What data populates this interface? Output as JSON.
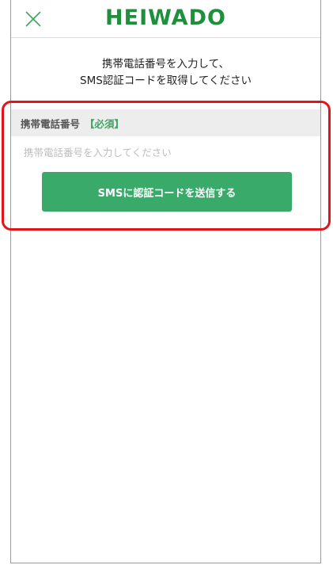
{
  "header": {
    "logo_text": "HEIWADO",
    "close_icon": "close-icon"
  },
  "intro": {
    "line1": "携帯電話番号を入力して、",
    "line2": "SMS認証コードを取得してください"
  },
  "form": {
    "label": "携帯電話番号",
    "required_badge": "【必須】",
    "phone_input": {
      "value": "",
      "placeholder": "携帯電話番号を入力してください"
    },
    "send_button_label": "SMSに認証コードを送信する"
  },
  "colors": {
    "brand_green": "#1e8f3c",
    "button_green": "#3aaa6b",
    "required_green": "#3aa861",
    "highlight_red": "#e4141d"
  }
}
